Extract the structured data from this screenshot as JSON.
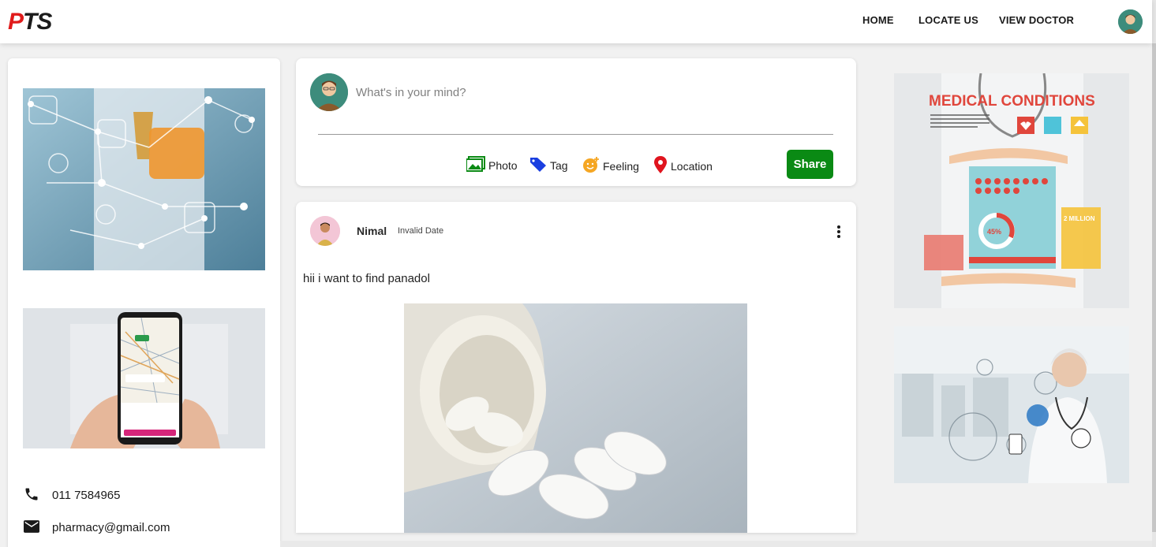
{
  "brand": {
    "logo_p": "P",
    "logo_ts": "TS"
  },
  "nav": {
    "home": "HOME",
    "locate": "LOCATE US",
    "doctor": "VIEW DOCTOR"
  },
  "composer": {
    "placeholder": "What's in your mind?",
    "actions": {
      "photo": "Photo",
      "tag": "Tag",
      "feeling": "Feeling",
      "location": "Location"
    },
    "share_label": "Share"
  },
  "post": {
    "author": "Nimal",
    "date": "Invalid Date",
    "text": "hii i want to find panadol"
  },
  "contact": {
    "phone": "011 7584965",
    "email": "pharmacy@gmail.com"
  },
  "ads": {
    "medical_title": "MEDICAL CONDITIONS",
    "medical_percent": "45%",
    "medical_million": "2 MILLION"
  },
  "colors": {
    "share_green": "#0a8a14",
    "logo_red": "#e01b1b",
    "location_red": "#e0141e",
    "tag_blue": "#1a3fe0",
    "photo_green": "#0a8a14",
    "feeling_orange": "#f5a623"
  },
  "icons": {
    "phone": "phone-icon",
    "email": "mail-icon",
    "photo": "photo-icon",
    "tag": "tag-icon",
    "feeling": "feeling-icon",
    "location": "location-pin-icon",
    "menu": "more-vertical-icon"
  }
}
